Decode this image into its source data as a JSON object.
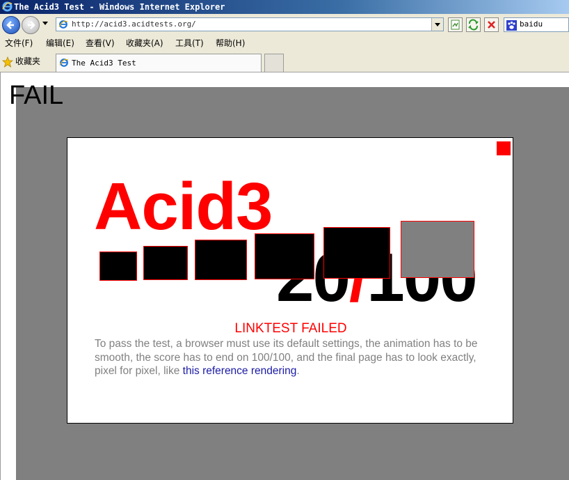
{
  "window": {
    "title": "The Acid3 Test - Windows Internet Explorer"
  },
  "toolbar": {
    "address": "http://acid3.acidtests.org/",
    "search_value": "baidu",
    "icons": [
      "back-arrow-icon",
      "forward-arrow-icon",
      "ie-page-icon",
      "compat-view-icon",
      "refresh-icon",
      "stop-icon",
      "baidu-paw-icon"
    ]
  },
  "menu": {
    "items": [
      "文件(F)",
      "编辑(E)",
      "查看(V)",
      "收藏夹(A)",
      "工具(T)",
      "帮助(H)"
    ]
  },
  "favorites": {
    "label": "收藏夹",
    "tab_title": "The Acid3 Test"
  },
  "page": {
    "status": "FAIL",
    "acid_title": "Acid3",
    "score_left": "20",
    "score_slash": "/",
    "score_right": "100",
    "error": "LINKTEST FAILED",
    "instructions_text": "To pass the test, a browser must use its default settings, the animation has to be smooth, the score has to end on 100/100, and the final page has to look exactly, pixel for pixel, like ",
    "link_text": "this reference rendering",
    "instructions_end": "."
  },
  "colors": {
    "accent_red": "#ff0000",
    "gray_background": "#808080",
    "link_blue": "#1a1aa6"
  }
}
